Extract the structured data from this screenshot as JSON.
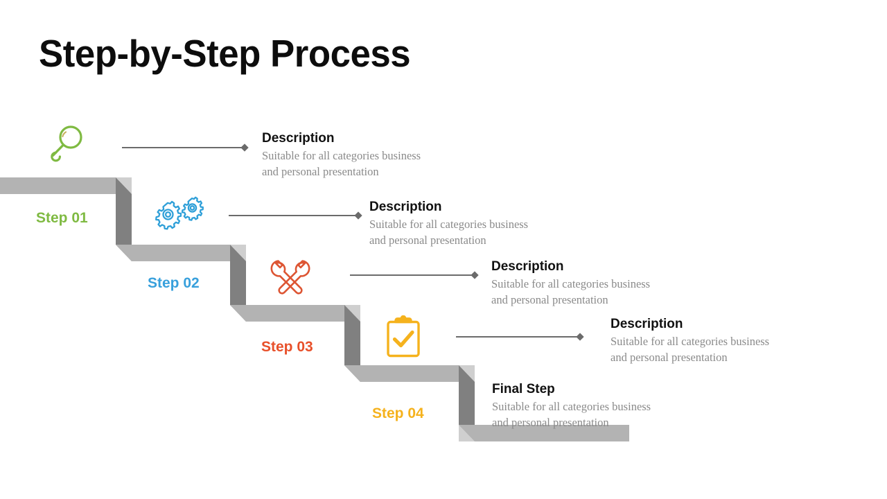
{
  "slide": {
    "title": "Step-by-Step Process",
    "background_color": "#ffffff"
  },
  "theme": {
    "tread_color": "#b3b3b3",
    "tread_chamfer_color": "#c9c9c9",
    "riser_color": "#808080",
    "riser_dark_color": "#6e6e6e",
    "connector_color": "#6b6b6b",
    "heading_color": "#111111",
    "body_color": "#8a8a8a",
    "title_color": "#0d0d0d"
  },
  "steps": [
    {
      "label": "Step 01",
      "label_color": "#7fba42",
      "icon": "magnifier-icon",
      "icon_color": "#7fba42",
      "has_connector": true,
      "heading": "Description",
      "body_line_1": "Suitable for all categories business",
      "body_line_2": "and personal presentation"
    },
    {
      "label": "Step 02",
      "label_color": "#38a0dc",
      "icon": "gears-icon",
      "icon_color": "#2e9fd8",
      "has_connector": true,
      "heading": "Description",
      "body_line_1": "Suitable for all categories business",
      "body_line_2": "and personal presentation"
    },
    {
      "label": "Step 03",
      "label_color": "#e8502a",
      "icon": "wrenches-icon",
      "icon_color": "#dd5533",
      "has_connector": true,
      "heading": "Description",
      "body_line_1": "Suitable for all categories business",
      "body_line_2": "and personal presentation"
    },
    {
      "label": "Step 04",
      "label_color": "#f5b21d",
      "icon": "clipboard-check-icon",
      "icon_color": "#f5b21d",
      "has_connector": true,
      "heading": "Description",
      "body_line_1": "Suitable for all categories business",
      "body_line_2": "and personal presentation"
    },
    {
      "label": "",
      "label_color": "",
      "icon": "",
      "icon_color": "",
      "has_connector": false,
      "heading": "Final Step",
      "body_line_1": "Suitable for all categories business",
      "body_line_2": "and personal presentation"
    }
  ]
}
